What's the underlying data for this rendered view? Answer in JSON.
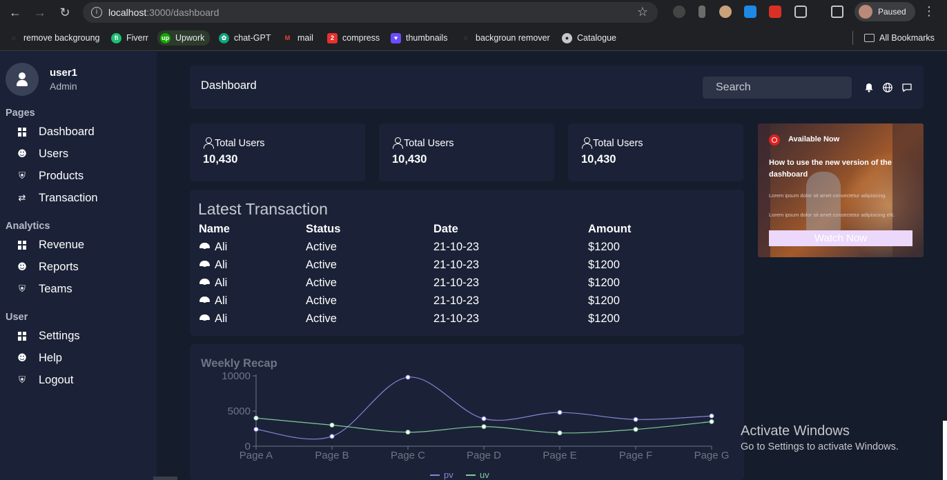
{
  "browser": {
    "url_host": "localhost",
    "url_path": ":3000/dashboard",
    "profile_label": "Paused",
    "bookmarks": [
      {
        "label": "remove backgroung",
        "icon": "fish-icon",
        "color": "#8fb4d8"
      },
      {
        "label": "Fiverr",
        "icon": "fiverr-icon",
        "color": "#1dbf73"
      },
      {
        "label": "Upwork",
        "icon": "upwork-icon",
        "color": "#14a800"
      },
      {
        "label": "chat-GPT",
        "icon": "openai-icon",
        "color": "#10a37f"
      },
      {
        "label": "mail",
        "icon": "gmail-icon",
        "color": "#ea4335"
      },
      {
        "label": "compress",
        "icon": "compress-icon",
        "color": "#e5322d"
      },
      {
        "label": "thumbnails",
        "icon": "heart-icon",
        "color": "#6b4dff"
      },
      {
        "label": "backgroun remover",
        "icon": "fish-icon",
        "color": "#8fb4d8"
      },
      {
        "label": "Catalogue",
        "icon": "globe-icon",
        "color": "#c7c7c7"
      }
    ],
    "all_bookmarks_label": "All Bookmarks"
  },
  "sidebar": {
    "user_name": "user1",
    "user_role": "Admin",
    "sections": [
      {
        "title": "Pages",
        "items": [
          {
            "label": "Dashboard",
            "icon": "grid-icon"
          },
          {
            "label": "Users",
            "icon": "smile-icon"
          },
          {
            "label": "Products",
            "icon": "basket-icon"
          },
          {
            "label": "Transaction",
            "icon": "swap-icon"
          }
        ]
      },
      {
        "title": "Analytics",
        "items": [
          {
            "label": "Revenue",
            "icon": "grid-icon"
          },
          {
            "label": "Reports",
            "icon": "smile-icon"
          },
          {
            "label": "Teams",
            "icon": "basket-icon"
          }
        ]
      },
      {
        "title": "User",
        "items": [
          {
            "label": "Settings",
            "icon": "grid-icon"
          },
          {
            "label": "Help",
            "icon": "smile-icon"
          },
          {
            "label": "Logout",
            "icon": "basket-icon"
          }
        ]
      }
    ]
  },
  "topbar": {
    "title": "Dashboard",
    "search_placeholder": "Search"
  },
  "stat_cards": [
    {
      "title": "Total Users",
      "value": "10,430"
    },
    {
      "title": "Total Users",
      "value": "10,430"
    },
    {
      "title": "Total Users",
      "value": "10,430"
    }
  ],
  "promo": {
    "badge": "Available Now",
    "heading": "How to use the new version of the dashboard",
    "lorem1": "Lorem ipsum dolor sit amet consectetur adipisicing.",
    "lorem2": "Lorem ipsum dolor sit amet consectetur adipisicing elit.",
    "button": "Watch Now"
  },
  "transactions": {
    "title": "Latest Transaction",
    "headers": [
      "Name",
      "Status",
      "Date",
      "Amount"
    ],
    "rows": [
      {
        "name": "Ali",
        "status": "Active",
        "date": "21-10-23",
        "amount": "$1200"
      },
      {
        "name": "Ali",
        "status": "Active",
        "date": "21-10-23",
        "amount": "$1200"
      },
      {
        "name": "Ali",
        "status": "Active",
        "date": "21-10-23",
        "amount": "$1200"
      },
      {
        "name": "Ali",
        "status": "Active",
        "date": "21-10-23",
        "amount": "$1200"
      },
      {
        "name": "Ali",
        "status": "Active",
        "date": "21-10-23",
        "amount": "$1200"
      }
    ]
  },
  "chart_data": {
    "type": "line",
    "title": "Weekly Recap",
    "categories": [
      "Page A",
      "Page B",
      "Page C",
      "Page D",
      "Page E",
      "Page F",
      "Page G"
    ],
    "series": [
      {
        "name": "pv",
        "color": "#8884d8",
        "values": [
          2400,
          1398,
          9800,
          3908,
          4800,
          3800,
          4300
        ]
      },
      {
        "name": "uv",
        "color": "#82ca9d",
        "values": [
          4000,
          3000,
          2000,
          2780,
          1890,
          2390,
          3490
        ]
      }
    ],
    "yticks": [
      0,
      5000,
      10000
    ],
    "ylim": [
      0,
      10000
    ],
    "grid": false,
    "legend": "bottom"
  },
  "watermark": {
    "line1": "Activate Windows",
    "line2": "Go to Settings to activate Windows."
  }
}
